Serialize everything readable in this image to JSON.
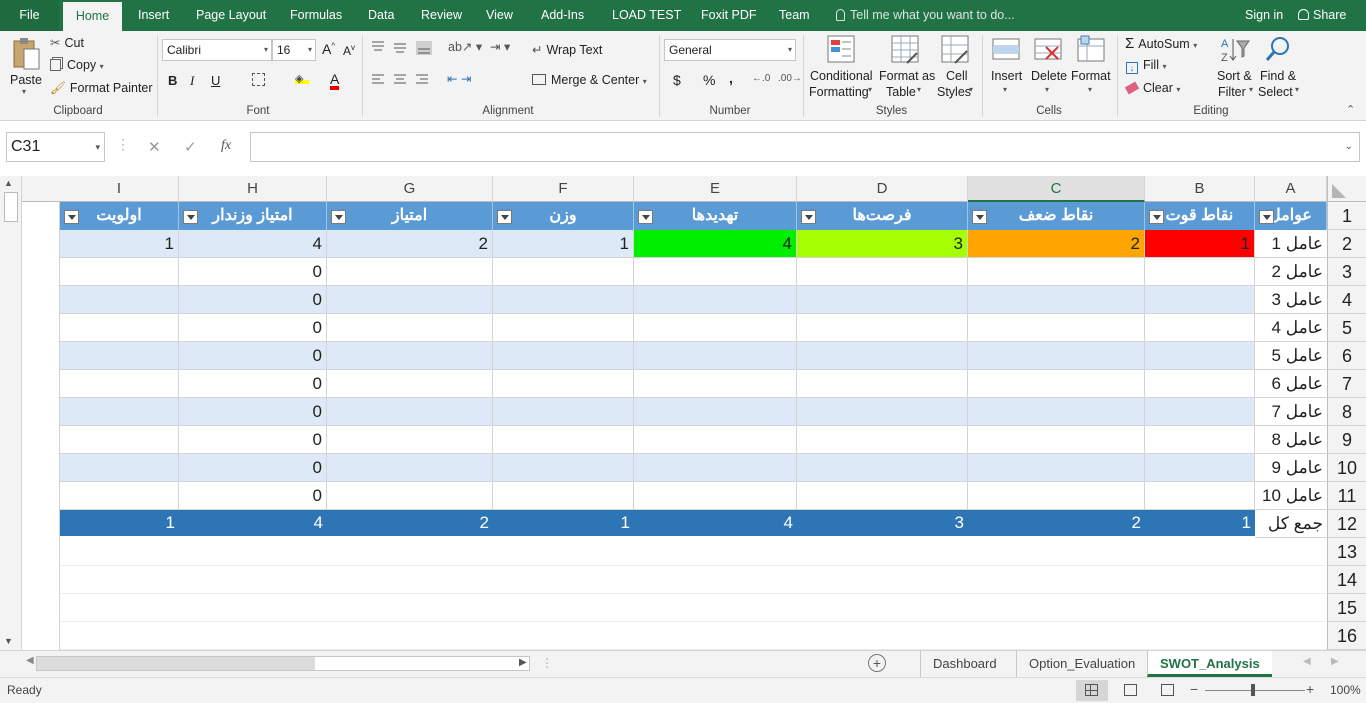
{
  "ribbon_tabs": [
    "File",
    "Home",
    "Insert",
    "Page Layout",
    "Formulas",
    "Data",
    "Review",
    "View",
    "Add-Ins",
    "LOAD TEST",
    "Foxit PDF",
    "Team"
  ],
  "tell_me": "Tell me what you want to do...",
  "signin": "Sign in",
  "share": "Share",
  "clipboard": {
    "paste": "Paste",
    "cut": "Cut",
    "copy": "Copy",
    "format_painter": "Format Painter",
    "label": "Clipboard"
  },
  "font": {
    "name": "Calibri",
    "size": "16",
    "label": "Font",
    "bold": "B",
    "italic": "I",
    "underline": "U"
  },
  "alignment": {
    "wrap": "Wrap Text",
    "merge": "Merge & Center",
    "label": "Alignment"
  },
  "number": {
    "format": "General",
    "currency": "$",
    "percent": "%",
    "comma": ",",
    "label": "Number"
  },
  "styles": {
    "cond_1": "Conditional",
    "cond_2": "Formatting",
    "table_1": "Format as",
    "table_2": "Table",
    "cell_1": "Cell",
    "cell_2": "Styles",
    "label": "Styles"
  },
  "cells": {
    "insert": "Insert",
    "delete": "Delete",
    "format": "Format",
    "label": "Cells"
  },
  "editing": {
    "autosum": "AutoSum",
    "fill": "Fill",
    "clear": "Clear",
    "sort_1": "Sort &",
    "sort_2": "Filter",
    "find_1": "Find &",
    "find_2": "Select",
    "label": "Editing"
  },
  "formula_bar": {
    "name_box": "C31",
    "fx": "fx",
    "formula": ""
  },
  "columns": [
    "I",
    "H",
    "G",
    "F",
    "E",
    "D",
    "C",
    "B",
    "A"
  ],
  "selected_column": "C",
  "row_numbers": [
    "1",
    "2",
    "3",
    "4",
    "5",
    "6",
    "7",
    "8",
    "9",
    "10",
    "11",
    "12",
    "13",
    "14",
    "15",
    "16"
  ],
  "table": {
    "headers": {
      "A": "عوامل",
      "B": "نقاط قوت",
      "C": "نقاط ضعف",
      "D": "فرصت‌ها",
      "E": "تهدیدها",
      "F": "وزن",
      "G": "امتیاز",
      "H": "امتیاز وزندار",
      "I": "اولویت"
    },
    "rows": [
      {
        "A": "عامل 1",
        "B": "1",
        "C": "2",
        "D": "3",
        "E": "4",
        "F": "1",
        "G": "2",
        "H": "4",
        "I": "1"
      },
      {
        "A": "عامل 2",
        "B": "",
        "C": "",
        "D": "",
        "E": "",
        "F": "",
        "G": "",
        "H": "0",
        "I": ""
      },
      {
        "A": "عامل 3",
        "B": "",
        "C": "",
        "D": "",
        "E": "",
        "F": "",
        "G": "",
        "H": "0",
        "I": ""
      },
      {
        "A": "عامل 4",
        "B": "",
        "C": "",
        "D": "",
        "E": "",
        "F": "",
        "G": "",
        "H": "0",
        "I": ""
      },
      {
        "A": "عامل 5",
        "B": "",
        "C": "",
        "D": "",
        "E": "",
        "F": "",
        "G": "",
        "H": "0",
        "I": ""
      },
      {
        "A": "عامل 6",
        "B": "",
        "C": "",
        "D": "",
        "E": "",
        "F": "",
        "G": "",
        "H": "0",
        "I": ""
      },
      {
        "A": "عامل 7",
        "B": "",
        "C": "",
        "D": "",
        "E": "",
        "F": "",
        "G": "",
        "H": "0",
        "I": ""
      },
      {
        "A": "عامل 8",
        "B": "",
        "C": "",
        "D": "",
        "E": "",
        "F": "",
        "G": "",
        "H": "0",
        "I": ""
      },
      {
        "A": "عامل 9",
        "B": "",
        "C": "",
        "D": "",
        "E": "",
        "F": "",
        "G": "",
        "H": "0",
        "I": ""
      },
      {
        "A": "عامل 10",
        "B": "",
        "C": "",
        "D": "",
        "E": "",
        "F": "",
        "G": "",
        "H": "0",
        "I": ""
      }
    ],
    "total": {
      "A": "جمع کل",
      "B": "1",
      "C": "2",
      "D": "3",
      "E": "4",
      "F": "1",
      "G": "2",
      "H": "4",
      "I": "1"
    },
    "row2_colors": {
      "B": "#ff0000",
      "C": "#ffa500",
      "D": "#a6ff00",
      "E": "#00ee00"
    },
    "header_color": "#5b9bd5",
    "band_color": "#dde9f6",
    "total_color": "#2e75b6"
  },
  "sheet_tabs": [
    "Dashboard",
    "Option_Evaluation",
    "SWOT_Analysis"
  ],
  "active_sheet": "SWOT_Analysis",
  "status": {
    "ready": "Ready",
    "zoom": "100%"
  },
  "accent": "#217346"
}
